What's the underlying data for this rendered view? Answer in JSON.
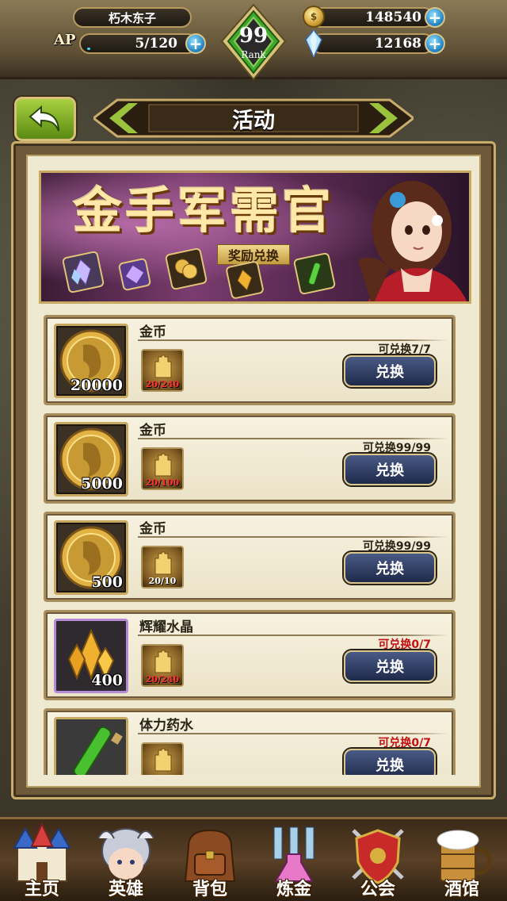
{
  "player": {
    "name": "朽木东子",
    "ap_label": "AP",
    "ap": "5/120",
    "gold": "148540",
    "crystals": "12168",
    "rank_value": "99",
    "rank_label": "Rank",
    "ap_fill_fraction": 0.04
  },
  "header": {
    "title": "活动"
  },
  "banner": {
    "title": "金手军需官",
    "subtitle": "奖励兑换"
  },
  "exchange_items": [
    {
      "name": "金币",
      "quantity": "20000",
      "cost": "20/240",
      "limit": "可兑换7/7",
      "button": "兑换",
      "icon": "gold-coin-icon"
    },
    {
      "name": "金币",
      "quantity": "5000",
      "cost": "20/100",
      "limit": "可兑换99/99",
      "button": "兑换",
      "icon": "gold-coin-icon"
    },
    {
      "name": "金币",
      "quantity": "500",
      "cost": "20/10",
      "limit": "可兑换99/99",
      "button": "兑换",
      "icon": "gold-coin-icon"
    },
    {
      "name": "辉耀水晶",
      "quantity": "400",
      "cost": "20/240",
      "limit": "可兑换0/7",
      "button": "兑换",
      "icon": "radiant-crystal-icon"
    },
    {
      "name": "体力药水",
      "quantity": "",
      "cost": "",
      "limit": "可兑换0/7",
      "button": "兑换",
      "icon": "stamina-potion-icon"
    }
  ],
  "nav": [
    {
      "label": "主页",
      "icon": "castle-icon"
    },
    {
      "label": "英雄",
      "icon": "hero-helmet-icon"
    },
    {
      "label": "背包",
      "icon": "backpack-icon"
    },
    {
      "label": "炼金",
      "icon": "alchemy-flask-icon"
    },
    {
      "label": "公会",
      "icon": "guild-shield-icon"
    },
    {
      "label": "酒馆",
      "icon": "tavern-mug-icon"
    }
  ],
  "colors": {
    "accent_gold": "#c9ac6a",
    "button_blue": "#1e2a4a",
    "limit_red": "#c41010",
    "rank_green": "#3fa82a"
  }
}
